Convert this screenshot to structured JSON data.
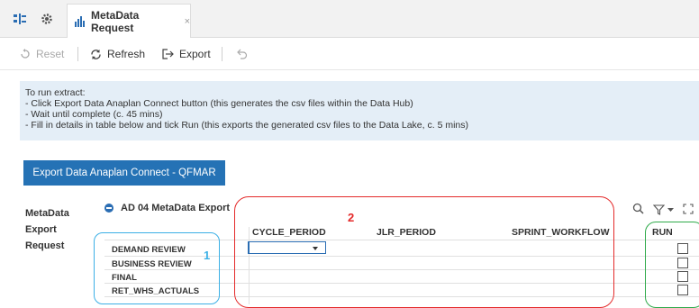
{
  "tabbar": {
    "icons": [
      "dashboard-grid-icon",
      "gear-icon"
    ],
    "tab": {
      "icon": "module-icon",
      "label": "MetaData Request",
      "close": "×"
    }
  },
  "toolbar": {
    "reset_label": "Reset",
    "refresh_label": "Refresh",
    "export_label": "Export",
    "undo_icon": "undo-icon"
  },
  "instructions": {
    "heading": "To run extract:",
    "lines": [
      "- Click Export Data Anaplan Connect button (this generates the csv files within the Data Hub)",
      "- Wait until complete (c. 45 mins)",
      "- Fill in details in table below and tick Run (this exports the generated csv files to the Data Lake, c. 5 mins)"
    ]
  },
  "export_button": {
    "label": "Export Data Anaplan Connect - QFMAR",
    "color": "#2572b5"
  },
  "section": {
    "label_lines": [
      "MetaData",
      "Export",
      "Request"
    ]
  },
  "module": {
    "title": "AD 04 MetaData Export",
    "tools": [
      "search-icon",
      "filter-icon",
      "expand-icon"
    ],
    "columns": [
      "CYCLE_PERIOD",
      "JLR_PERIOD",
      "SPRINT_WORKFLOW",
      "RUN"
    ],
    "rows": [
      "DEMAND REVIEW",
      "BUSINESS REVIEW",
      "FINAL",
      "RET_WHS_ACTUALS"
    ]
  },
  "annotations": {
    "blue": {
      "number": "1",
      "color": "#3cb0e6"
    },
    "red": {
      "number": "2",
      "color": "#e42a2a"
    },
    "green": {
      "color": "#2faa4a"
    }
  }
}
